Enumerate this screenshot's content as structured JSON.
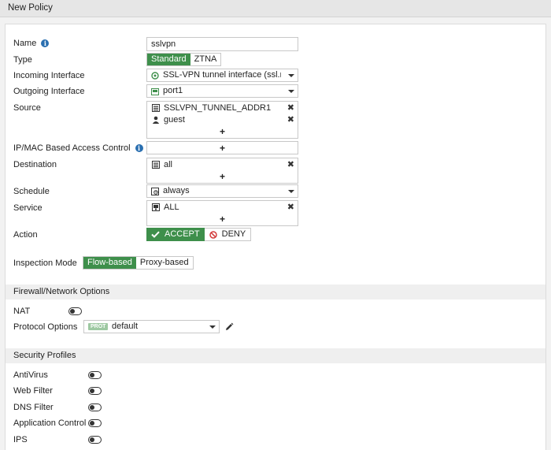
{
  "header": {
    "title": "New Policy"
  },
  "form": {
    "name": {
      "label": "Name",
      "value": "sslvpn"
    },
    "type": {
      "label": "Type",
      "options": [
        "Standard",
        "ZTNA"
      ],
      "selected": "Standard"
    },
    "incoming": {
      "label": "Incoming Interface",
      "value": "SSL-VPN tunnel interface (ssl.root)"
    },
    "outgoing": {
      "label": "Outgoing Interface",
      "value": "port1"
    },
    "source": {
      "label": "Source",
      "items": [
        "SSLVPN_TUNNEL_ADDR1",
        "guest"
      ],
      "add": "+"
    },
    "ipmac": {
      "label": "IP/MAC Based Access Control",
      "add": "+"
    },
    "destination": {
      "label": "Destination",
      "items": [
        "all"
      ],
      "add": "+"
    },
    "schedule": {
      "label": "Schedule",
      "value": "always"
    },
    "service": {
      "label": "Service",
      "items": [
        "ALL"
      ],
      "add": "+"
    },
    "action": {
      "label": "Action",
      "accept": "ACCEPT",
      "deny": "DENY",
      "selected": "ACCEPT"
    },
    "inspection": {
      "label": "Inspection Mode",
      "options": [
        "Flow-based",
        "Proxy-based"
      ],
      "selected": "Flow-based"
    }
  },
  "firewall": {
    "title": "Firewall/Network Options",
    "nat": {
      "label": "NAT",
      "enabled": false
    },
    "protocol": {
      "label": "Protocol Options",
      "badge": "PROT",
      "value": "default"
    }
  },
  "security": {
    "title": "Security Profiles",
    "items": [
      {
        "label": "AntiVirus",
        "enabled": false
      },
      {
        "label": "Web Filter",
        "enabled": false
      },
      {
        "label": "DNS Filter",
        "enabled": false
      },
      {
        "label": "Application Control",
        "enabled": false
      },
      {
        "label": "IPS",
        "enabled": false
      }
    ]
  },
  "colors": {
    "accent": "#3e8f4b",
    "info": "#2a6fb0",
    "deny": "#d33c3c"
  }
}
